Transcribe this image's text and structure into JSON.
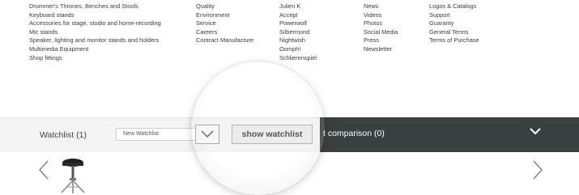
{
  "footer": {
    "col1": [
      "Drummer's Thrones, Benches and Stools",
      "Keyboard stands",
      "Accessories for stage, studio and home-recording",
      "Mic stands",
      "Speaker, lighting and monitor stands and holders",
      "Multimedia Equipment",
      "Shop fittings"
    ],
    "col2": [
      "Quality",
      "Environment",
      "Service",
      "Careers",
      "Contract Manufacture"
    ],
    "col3": [
      "Julien K",
      "Accept",
      "Powerwolf",
      "Silbermond",
      "Nightwish",
      "Oomph!",
      "Schlierenspiel"
    ],
    "col4": [
      "News",
      "Videos",
      "Photos",
      "Social Media",
      "Press",
      "Newsletter"
    ],
    "col5": [
      "Logos & Catalogs",
      "Support",
      "Guaranty",
      "General Terms",
      "Terms of Purchase"
    ]
  },
  "watchlist": {
    "title": "Watchlist (1)",
    "select_value": "New Watchlist",
    "show_button": "show watchlist"
  },
  "comparison": {
    "label": "t comparison (0)"
  },
  "icons": {
    "dropdown": "chevron-down-icon",
    "collapse": "chevron-down-icon",
    "prev": "chevron-left-icon",
    "next": "chevron-right-icon"
  },
  "colors": {
    "dark_bar": "#3a3f40",
    "light_bar": "#f4f4f4"
  }
}
